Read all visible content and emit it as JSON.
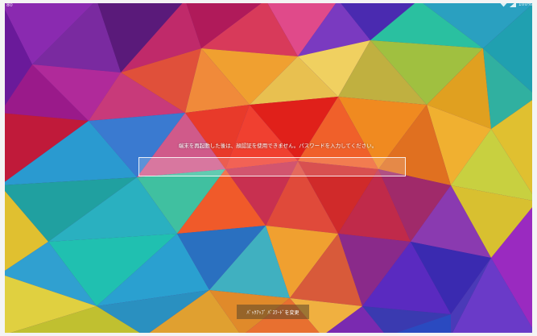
{
  "status_bar": {
    "left_text": "80",
    "battery_text": "100%",
    "signal_icon": "signal-icon",
    "wifi_icon": "wifi-icon"
  },
  "lock_screen": {
    "prompt": "端末を再起動した後は、顔認証を使用できません。パスワードを入力してください。",
    "password_value": "",
    "change_button_label": "ﾊﾞｯｸｱｯﾌﾟ ﾊﾟｽﾜｰﾄﾞを変更"
  },
  "colors": {
    "wallpaper": [
      "#5a1a8a",
      "#d43a6a",
      "#f0a020",
      "#e23a1a",
      "#2ab0a0",
      "#3a8ad0",
      "#9a2ac0",
      "#f0d040"
    ]
  }
}
